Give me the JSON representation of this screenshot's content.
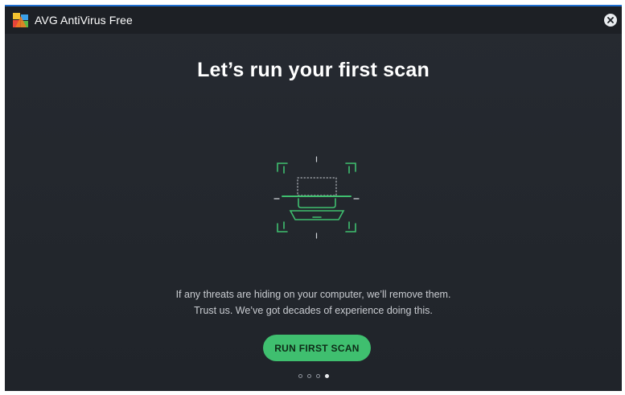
{
  "window": {
    "title": "AVG AntiVirus Free",
    "close_icon": "close-icon",
    "logo_icon": "avg-logo-icon",
    "accent_color": "#1f6fd0"
  },
  "main": {
    "headline": "Let’s run your first scan",
    "illustration_icon": "laptop-scan-icon",
    "illustration_color": "#3fbf6f",
    "description_line1": "If any threats are hiding on your computer, we’ll remove them.",
    "description_line2": "Trust us. We’ve got decades of experience doing this.",
    "cta_label": "RUN FIRST SCAN",
    "cta_color": "#3fbf6f"
  },
  "pagination": {
    "total": 4,
    "current": 4
  }
}
